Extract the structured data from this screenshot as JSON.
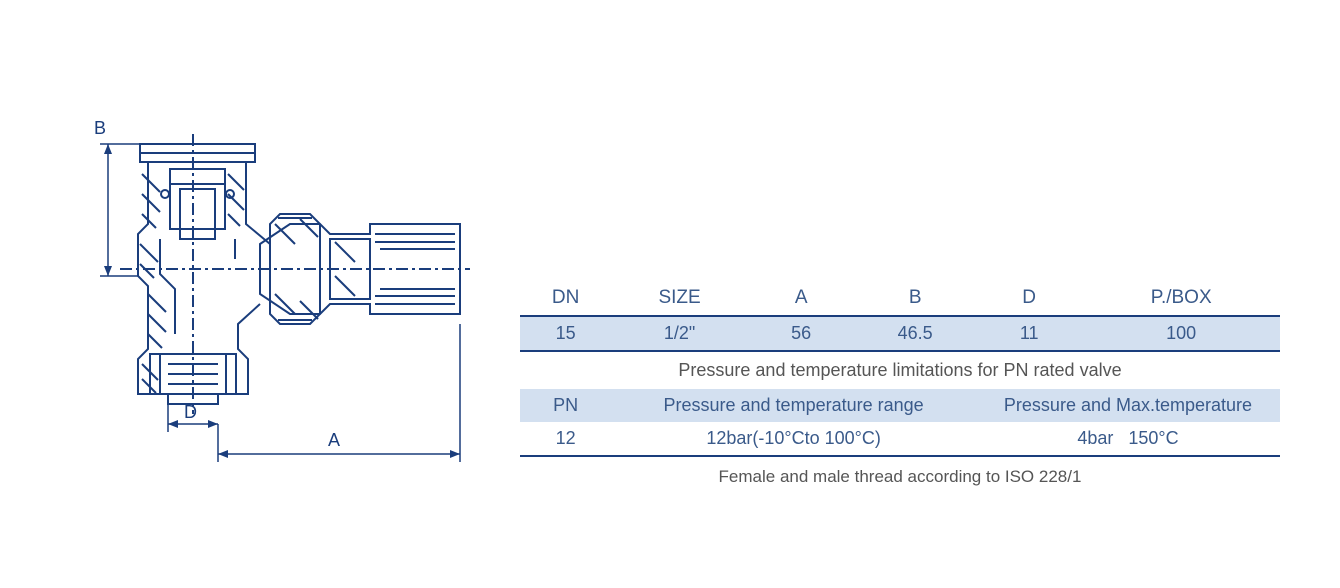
{
  "drawing": {
    "labels": {
      "A": "A",
      "B": "B",
      "D": "D"
    },
    "stroke": "#1a3d7c"
  },
  "table1": {
    "headers": [
      "DN",
      "SIZE",
      "A",
      "B",
      "D",
      "P./BOX"
    ],
    "row": [
      "15",
      "1/2\"",
      "56",
      "46.5",
      "11",
      "100"
    ]
  },
  "limitations_caption": "Pressure and temperature limitations for PN rated valve",
  "table2": {
    "headers": [
      "PN",
      "Pressure and temperature range",
      "Pressure and Max.temperature"
    ],
    "row": [
      "12",
      "12bar(-10°Cto 100°C)",
      "4bar   150°C"
    ]
  },
  "footer": "Female and male thread according to ISO 228/1"
}
